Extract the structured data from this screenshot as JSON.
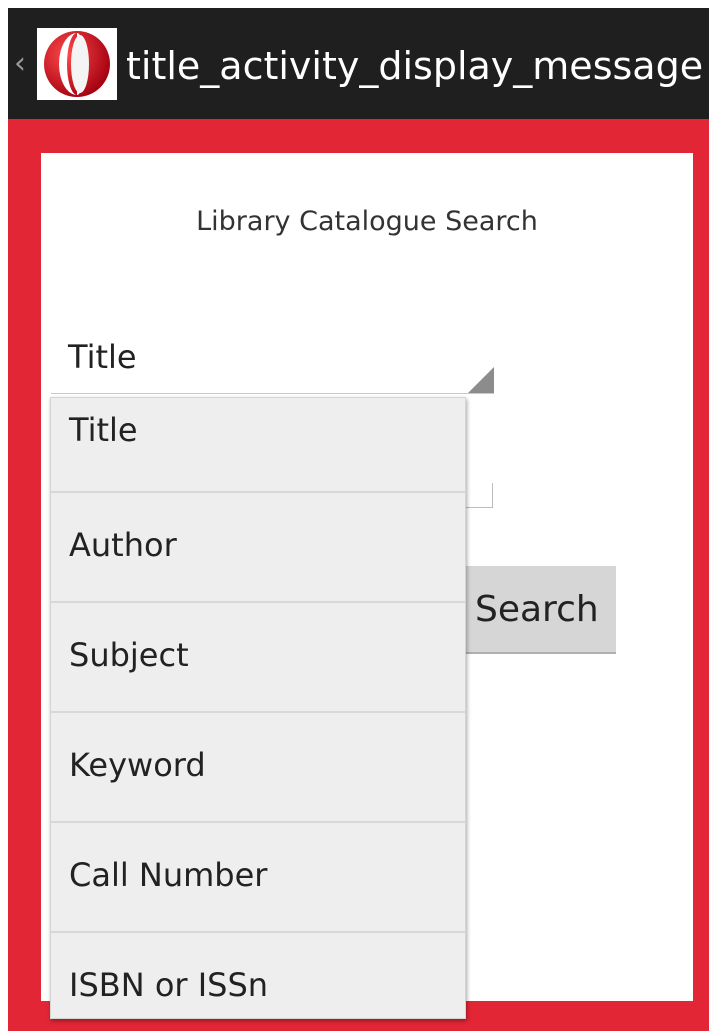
{
  "action_bar": {
    "title": "title_activity_display_message",
    "up_glyph": "‹",
    "app_icon": "red-crescent-logo-icon",
    "background": "#1f1f1f"
  },
  "colors": {
    "brand_red": "#e32636",
    "card": "#ffffff",
    "dropdown_bg": "#eeeeee"
  },
  "form": {
    "heading": "Library Catalogue Search",
    "spinner_value": "Title",
    "search_button_label": "Search"
  },
  "dropdown": {
    "options": [
      "Title",
      "Author",
      "Subject",
      "Keyword",
      "Call Number",
      "ISBN or ISSn"
    ]
  }
}
